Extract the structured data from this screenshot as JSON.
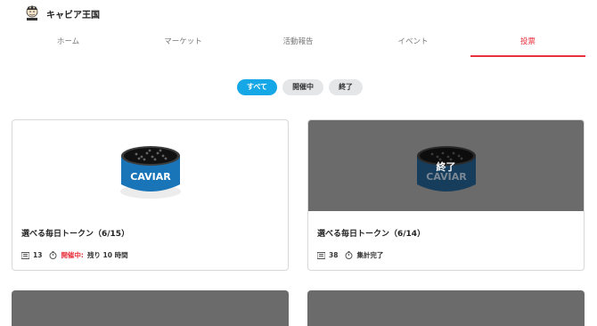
{
  "header": {
    "title": "キャビア王国",
    "logo_icon": "caviar-king-logo"
  },
  "nav": {
    "tabs": [
      {
        "label": "ホーム"
      },
      {
        "label": "マーケット"
      },
      {
        "label": "活動報告"
      },
      {
        "label": "イベント"
      },
      {
        "label": "投票",
        "active": true
      }
    ]
  },
  "filters": [
    {
      "label": "すべて",
      "active": true
    },
    {
      "label": "開催中"
    },
    {
      "label": "終了"
    }
  ],
  "cards": [
    {
      "title": "選べる毎日トークン（6/15）",
      "count": "13",
      "status": "開催中:",
      "remaining": "残り 10 時間",
      "image": "caviar-tin",
      "can_label": "CAVIAR",
      "ended": false
    },
    {
      "title": "選べる毎日トークン（6/14）",
      "count": "38",
      "status": "集計完了",
      "image": "caviar-tin",
      "can_label": "CAVIAR",
      "ended": true,
      "overlay_label": "終了"
    }
  ],
  "colors": {
    "accent": "#e8313c",
    "pill_active": "#16a8e6",
    "overlay": "#6b6b6b"
  }
}
